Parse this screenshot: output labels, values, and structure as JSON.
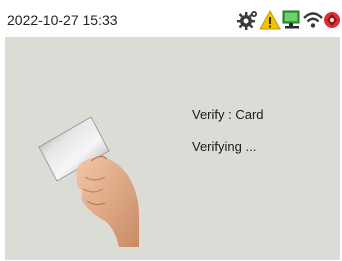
{
  "status_bar": {
    "datetime": "2022-10-27 15:33",
    "icons": [
      "gear-icon",
      "warning-icon",
      "network-monitor-icon",
      "wifi-icon",
      "alarm-icon"
    ]
  },
  "verify": {
    "mode_text": "Verify : Card",
    "status_text": "Verifying ..."
  },
  "colors": {
    "screen_bg": "#dcdcd6",
    "status_bar_bg": "#ffffff",
    "warning": "#f2c200",
    "network": "#3aa33a",
    "alarm": "#d93030"
  }
}
